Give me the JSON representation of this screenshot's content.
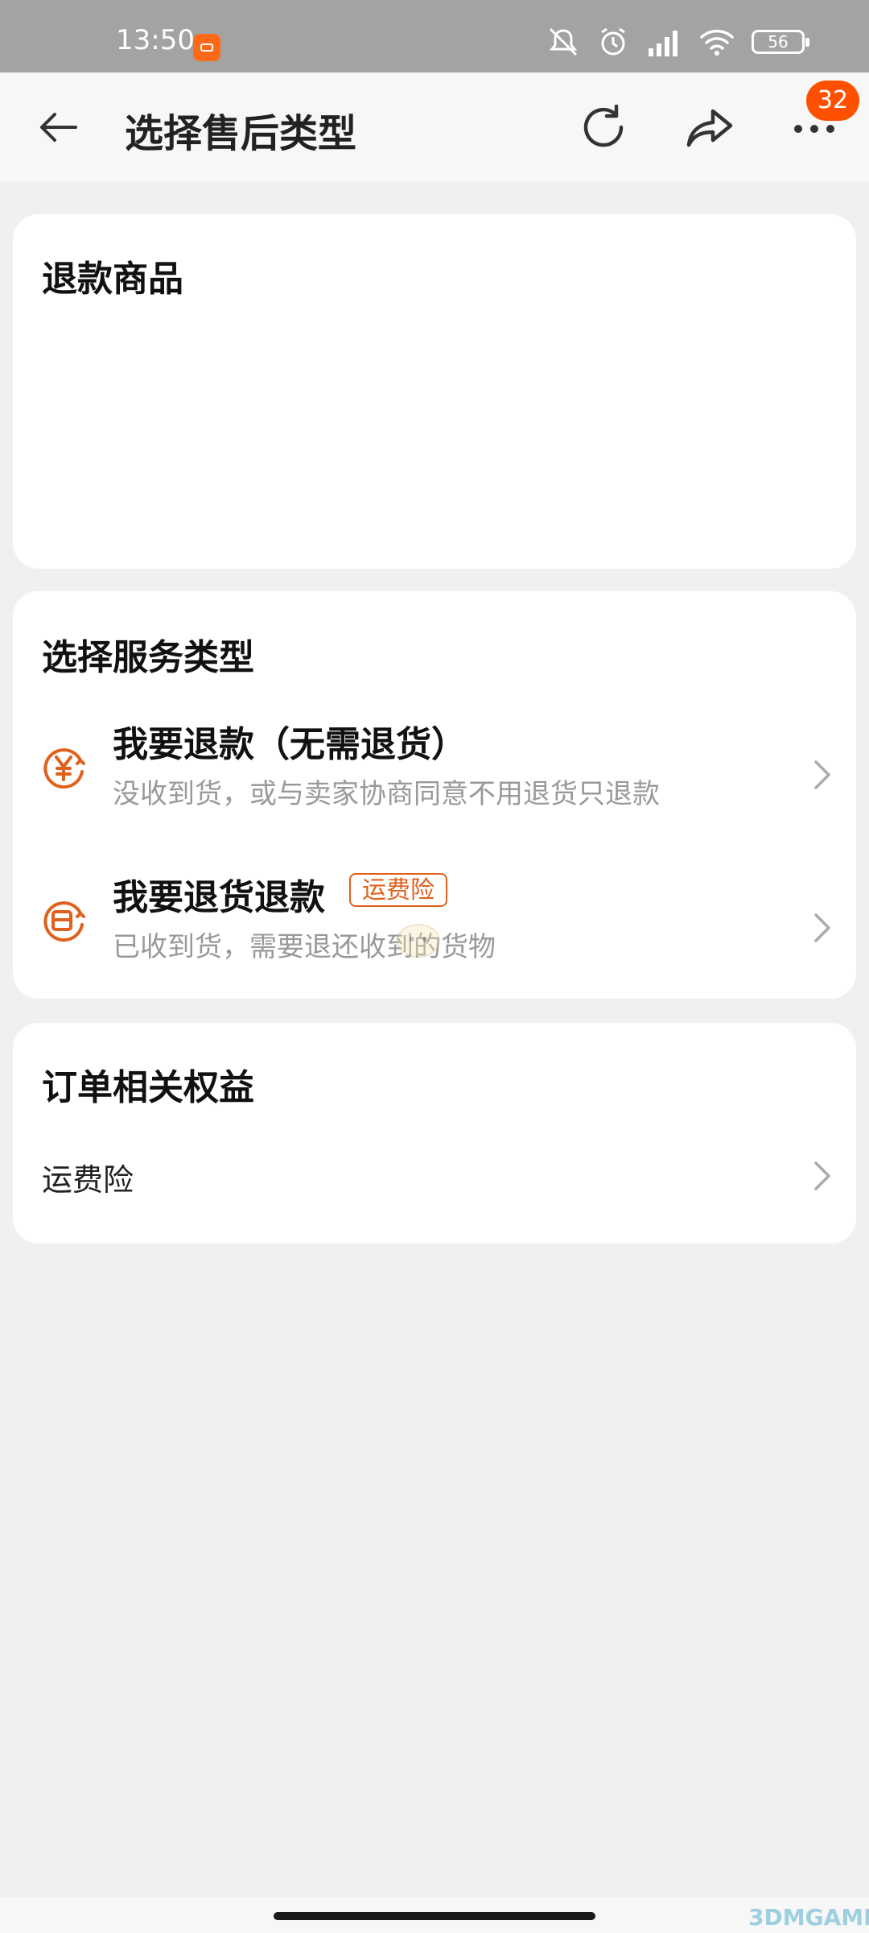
{
  "status_bar": {
    "time": "13:50",
    "battery": "56"
  },
  "nav": {
    "title": "选择售后类型",
    "badge_count": "32"
  },
  "refund_items": {
    "title": "退款商品"
  },
  "service_type": {
    "title": "选择服务类型",
    "options": [
      {
        "title": "我要退款（无需退货）",
        "desc": "没收到货，或与卖家协商同意不用退货只退款",
        "icon": "yen-refund-icon"
      },
      {
        "title": "我要退货退款",
        "tag": "运费险",
        "desc": "已收到货，需要退还收到的货物",
        "icon": "return-goods-icon"
      }
    ]
  },
  "order_benefits": {
    "title": "订单相关权益",
    "items": [
      {
        "label": "运费险"
      }
    ]
  },
  "watermark": {
    "text": "3DMGAME"
  },
  "colors": {
    "accent": "#ff5000",
    "tag": "#e0601d",
    "background": "#f0f0f0"
  }
}
